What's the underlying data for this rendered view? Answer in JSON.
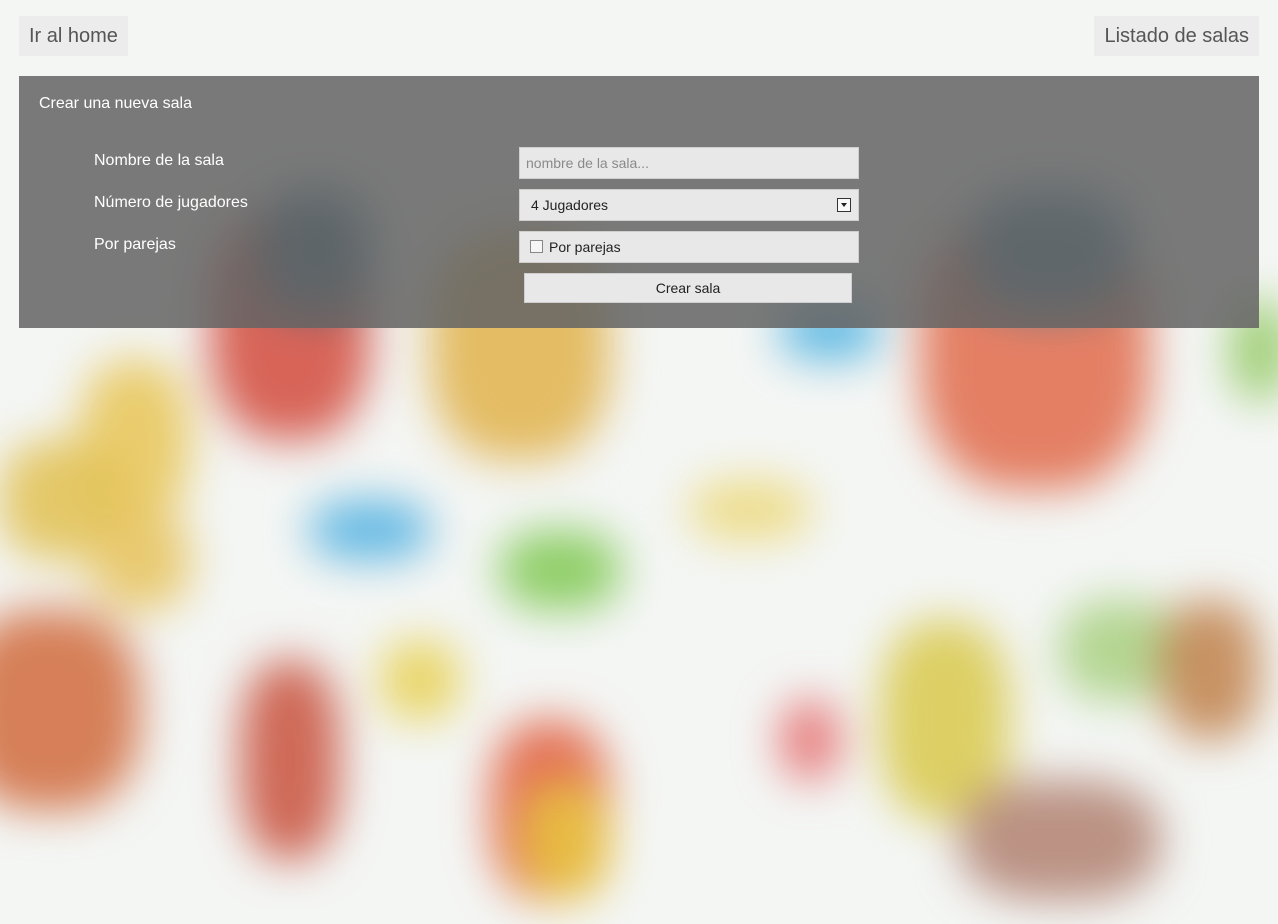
{
  "nav": {
    "home_label": "Ir al home",
    "list_label": "Listado de salas"
  },
  "form": {
    "title": "Crear una nueva sala",
    "name_label": "Nombre de la sala",
    "name_placeholder": "nombre de la sala...",
    "name_value": "",
    "players_label": "Número de jugadores",
    "players_selected": "4 Jugadores",
    "pairs_label": "Por parejas",
    "pairs_checkbox_label": "Por parejas",
    "pairs_checked": false,
    "submit_label": "Crear sala"
  },
  "colors": {
    "panel_bg": "#646464",
    "button_bg": "#e8e8e8",
    "text_light": "#ffffff"
  }
}
